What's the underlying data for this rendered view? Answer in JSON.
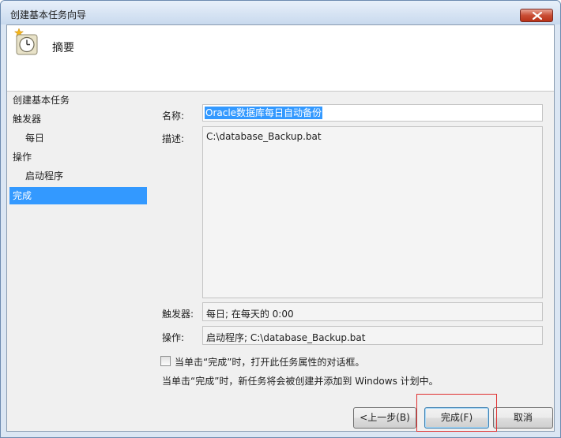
{
  "window": {
    "title": "创建基本任务向导"
  },
  "header": {
    "title": "摘要",
    "icon": "clock-icon"
  },
  "sidebar": {
    "items": [
      {
        "label": "创建基本任务"
      },
      {
        "label": "触发器"
      },
      {
        "label": "每日"
      },
      {
        "label": "操作"
      },
      {
        "label": "启动程序"
      },
      {
        "label": "完成"
      }
    ]
  },
  "form": {
    "name_label": "名称:",
    "name_value": "Oracle数据库每日自动备份",
    "desc_label": "描述:",
    "desc_value": "C:\\database_Backup.bat",
    "trigger_label": "触发器:",
    "trigger_value": "每日; 在每天的 0:00",
    "action_label": "操作:",
    "action_value": "启动程序; C:\\database_Backup.bat",
    "checkbox_label": "当单击“完成”时，打开此任务属性的对话框。",
    "info_text": "当单击“完成”时，新任务将会被创建并添加到 Windows 计划中。"
  },
  "buttons": {
    "back": "<上一步(B)",
    "finish": "完成(F)",
    "cancel": "取消"
  },
  "colors": {
    "selection": "#3399ff",
    "highlight_box": "#e03030"
  }
}
